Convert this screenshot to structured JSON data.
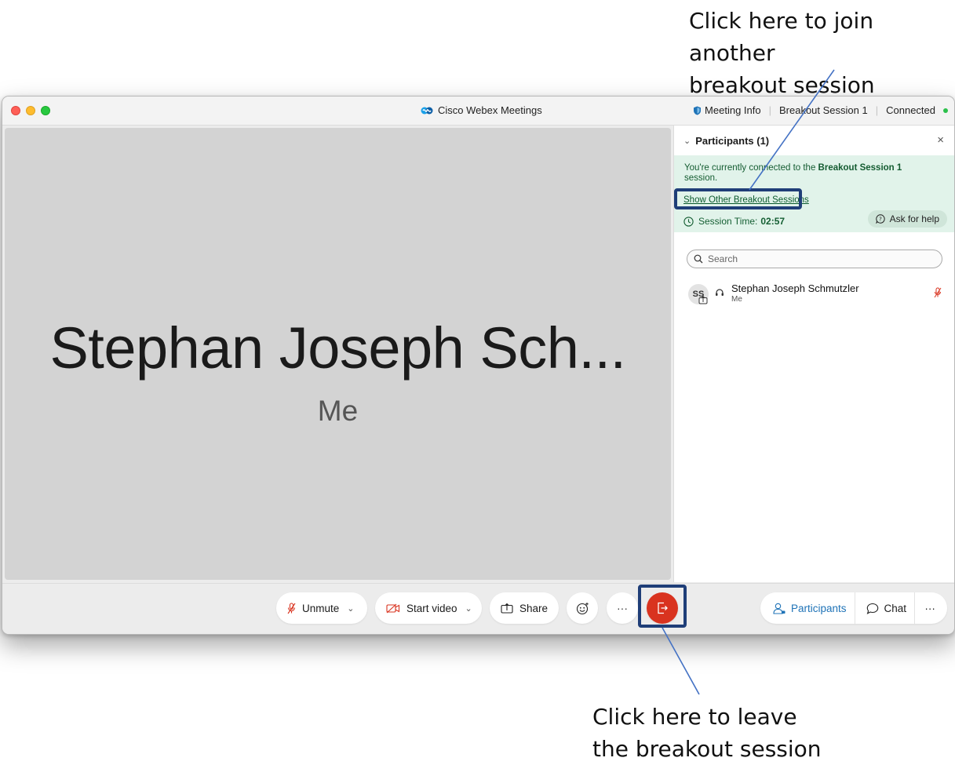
{
  "annotations": {
    "top_callout": "Click here to join another\nbreakout session",
    "bottom_callout": "Click here to leave\nthe breakout session"
  },
  "window": {
    "title": "Cisco Webex Meetings",
    "meeting_info": "Meeting Info",
    "session_name": "Breakout Session 1",
    "status": "Connected"
  },
  "stage": {
    "name": "Stephan Joseph Sch...",
    "subtitle": "Me"
  },
  "panel": {
    "title": "Participants (1)",
    "banner_prefix": "You're currently connected to the ",
    "banner_session": "Breakout Session 1",
    "banner_suffix": " session.",
    "show_sessions_link": "Show Other Breakout Sessions",
    "session_time_label": "Session Time:",
    "session_time_value": "02:57",
    "ask_help": "Ask for help",
    "search_placeholder": "Search",
    "participants": [
      {
        "initials": "SS",
        "name": "Stephan Joseph Schmutzler",
        "role": "Me"
      }
    ]
  },
  "toolbar": {
    "unmute": "Unmute",
    "start_video": "Start video",
    "share": "Share",
    "participants": "Participants",
    "chat": "Chat",
    "more": "···"
  },
  "colors": {
    "accent": "#1f73b7",
    "leave_red": "#d9331f",
    "banner_bg": "#e1f3ea",
    "highlight": "#1f3e78"
  }
}
